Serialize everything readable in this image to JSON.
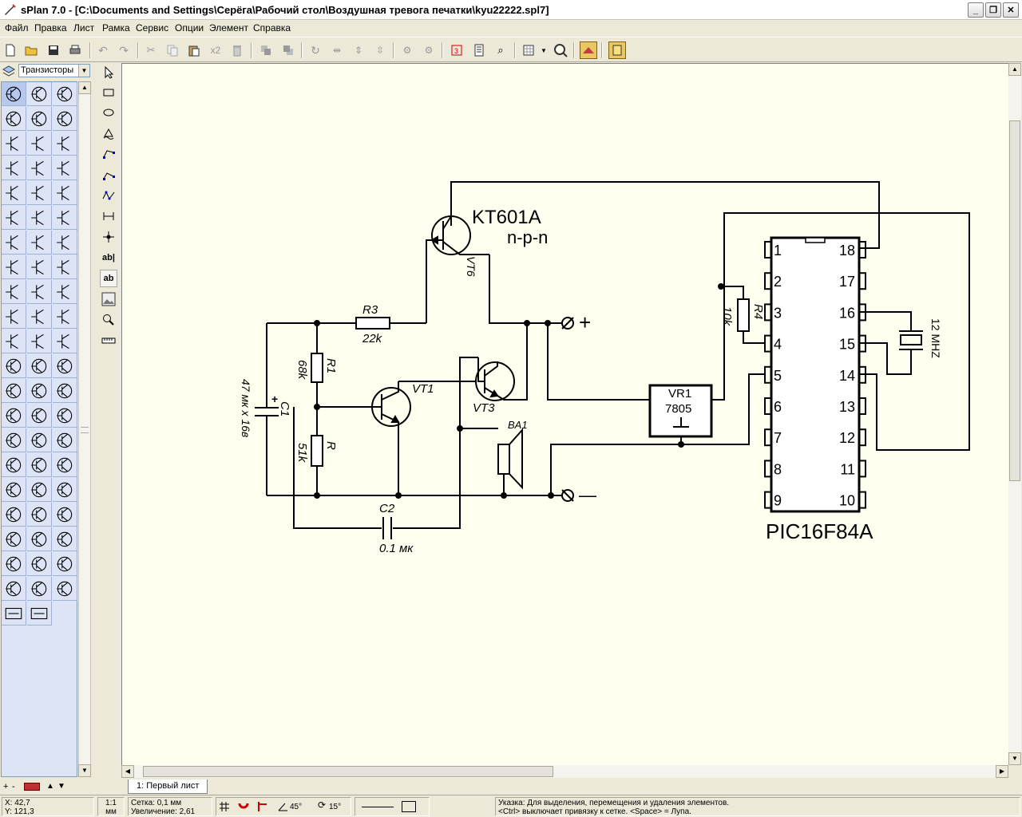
{
  "window": {
    "title": "sPlan 7.0 - [C:\\Documents and Settings\\Серёга\\Рабочий стол\\Воздушная тревога печатки\\kyu22222.spl7]"
  },
  "menu": [
    "Файл",
    "Правка",
    "Лист",
    "Рамка",
    "Сервис",
    "Опции",
    "Элемент",
    "Справка"
  ],
  "toolbar": {
    "buttons": [
      "new",
      "open",
      "save",
      "print",
      "undo",
      "redo",
      "cut",
      "copy",
      "paste",
      "x2",
      "delete",
      "to-front",
      "to-back",
      "rotate",
      "mirror-h",
      "mirror-v",
      "mirror-v2",
      "group",
      "ungroup",
      "numbering",
      "list",
      "search",
      "grid",
      "zoom",
      "layers",
      "page"
    ],
    "x2_label": "x2"
  },
  "library": {
    "selected": "Транзисторы"
  },
  "canvas": {
    "labels": {
      "kt601a": "KT601A",
      "npn": "n-p-n",
      "vt6": "VT6",
      "r3": "R3",
      "r3_val": "22k",
      "r1": "R1",
      "r1_val": "68k",
      "r": "R",
      "r_val": "51k",
      "c1": "C1",
      "c1_val": "47 мк х 16в",
      "c1_plus": "+",
      "vt1": "VT1",
      "vt3": "VT3",
      "ba1": "BA1",
      "c2": "C2",
      "c2_val": "0.1 мк",
      "vr1": "VR1",
      "vr1_val": "7805",
      "r4": "R4",
      "r4_val": "10k",
      "crystal": "12 MHZ",
      "chip": "PIC16F84A",
      "plus": "+",
      "minus": "—"
    },
    "pins_left": [
      "1",
      "2",
      "3",
      "4",
      "5",
      "6",
      "7",
      "8",
      "9"
    ],
    "pins_right": [
      "18",
      "17",
      "16",
      "15",
      "14",
      "13",
      "12",
      "11",
      "10"
    ]
  },
  "sheet_tab": "1: Первый лист",
  "status": {
    "x": "X: 42,7",
    "y": "Y: 121,3",
    "scale_top": "1:1",
    "scale_unit": "мм",
    "grid_label": "Сетка: 0,1 мм",
    "zoom_label": "Увеличение:",
    "zoom_value": "2,61",
    "angle1": "45°",
    "angle2": "15°",
    "hint1": "Указка: Для выделения, перемещения и удаления элементов.",
    "hint2": "<Ctrl> выключает привязку к сетке. <Space> = Лупа."
  }
}
